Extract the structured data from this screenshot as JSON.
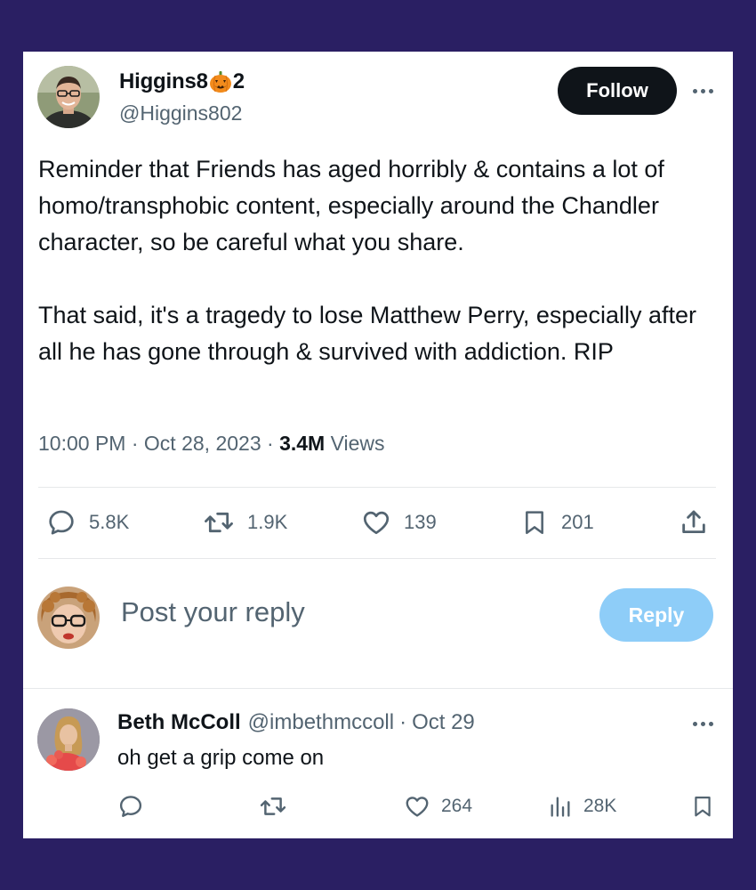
{
  "tweet": {
    "author": {
      "name_before": "Higgins8",
      "name_after": "2",
      "name_emoji": "jack-o-lantern-emoji",
      "handle": "@Higgins802"
    },
    "follow_label": "Follow",
    "text": "Reminder that Friends has aged horribly & contains a lot of homo/transphobic content, especially around the Chandler character, so be careful what you share.\n\nThat said, it's a tragedy to lose Matthew Perry, especially after all he has gone through & survived with addiction. RIP",
    "time": "10:00 PM",
    "date": "Oct 28, 2023",
    "separator": "·",
    "views_count": "3.4M",
    "views_label": "Views",
    "stats": {
      "replies": "5.8K",
      "reposts": "1.9K",
      "likes": "139",
      "bookmarks": "201"
    },
    "icons": [
      "reply-icon",
      "repost-icon",
      "like-icon",
      "bookmark-icon",
      "share-icon",
      "more-icon"
    ]
  },
  "reply_box": {
    "placeholder": "Post your reply",
    "button_label": "Reply"
  },
  "reply": {
    "name": "Beth McColl",
    "handle": "@imbethmccoll",
    "separator": "·",
    "date": "Oct 29",
    "text": "oh get a grip come on",
    "stats": {
      "likes": "264",
      "views": "28K"
    }
  },
  "colors": {
    "background": "#2a1f63",
    "card": "#ffffff",
    "text": "#0f1419",
    "secondary": "#536471",
    "follow_button": "#0f1419",
    "reply_button": "#8ecdf8"
  }
}
